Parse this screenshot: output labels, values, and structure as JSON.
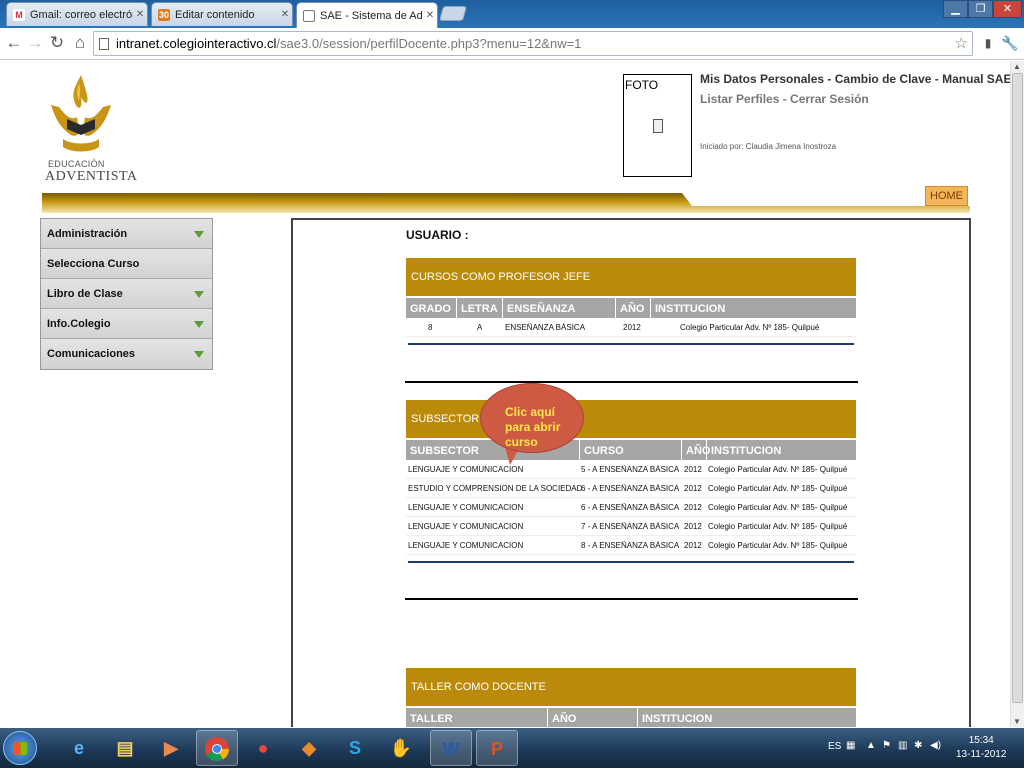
{
  "browser": {
    "tabs": [
      {
        "label": "Gmail: correo electrónico c",
        "icon": "gmail-icon"
      },
      {
        "label": "Editar contenido",
        "icon": "site-icon"
      },
      {
        "label": "SAE - Sistema de Administ",
        "icon": "page-icon",
        "active": true
      }
    ],
    "url_host": "intranet.colegiointeractivo.cl",
    "url_path": "/sae3.0/session/perfilDocente.php3?menu=12&nw=1"
  },
  "header": {
    "logo_line1": "EDUCACIÓN",
    "logo_line2": "ADVENTISTA",
    "foto_label": "FOTO",
    "links": {
      "mis_datos": "Mis Datos Personales",
      "cambio_clave": "Cambio de Clave",
      "manual": "Manual SAE",
      "listar_perfiles": "Listar Perfiles",
      "cerrar_sesion": "Cerrar Sesión",
      "sep": " - "
    },
    "session_info": "Iniciado por: Claudia Jimena Inostroza",
    "home": "HOME"
  },
  "sidebar": {
    "items": [
      {
        "label": "Administración",
        "has_submenu": true
      },
      {
        "label": "Selecciona Curso",
        "has_submenu": false
      },
      {
        "label": "Libro de Clase",
        "has_submenu": true
      },
      {
        "label": "Info.Colegio",
        "has_submenu": true
      },
      {
        "label": "Comunicaciones",
        "has_submenu": true
      }
    ]
  },
  "main": {
    "usuario_label": "USUARIO :",
    "profesor_jefe": {
      "title": "CURSOS COMO PROFESOR JEFE",
      "columns": [
        "GRADO",
        "LETRA",
        "ENSEÑANZA",
        "AÑO",
        "INSTITUCION"
      ],
      "rows": [
        [
          "8",
          "A",
          "ENSEÑANZA BÁSICA",
          "2012",
          "Colegio Particular Adv. Nº 185- Quilpué"
        ]
      ]
    },
    "subsector": {
      "title": "SUBSECTOR CO",
      "columns": [
        "SUBSECTOR",
        "CURSO",
        "AÑO",
        "INSTITUCION"
      ],
      "rows": [
        [
          "LENGUAJE Y COMUNICACION",
          "5 - A ENSEÑANZA BÁSICA",
          "2012",
          "Colegio Particular Adv. Nº 185- Quilpué"
        ],
        [
          "ESTUDIO Y COMPRENSION DE LA SOCIEDAD",
          "6 - A ENSEÑANZA BÁSICA",
          "2012",
          "Colegio Particular Adv. Nº 185- Quilpué"
        ],
        [
          "LENGUAJE Y COMUNICACION",
          "6 - A ENSEÑANZA BÁSICA",
          "2012",
          "Colegio Particular Adv. Nº 185- Quilpué"
        ],
        [
          "LENGUAJE Y COMUNICACION",
          "7 - A ENSEÑANZA BÁSICA",
          "2012",
          "Colegio Particular Adv. Nº 185- Quilpué"
        ],
        [
          "LENGUAJE Y COMUNICACION",
          "8 - A ENSEÑANZA BÁSICA",
          "2012",
          "Colegio Particular Adv. Nº 185- Quilpué"
        ]
      ]
    },
    "taller": {
      "title": "TALLER COMO DOCENTE",
      "columns": [
        "TALLER",
        "AÑO",
        "INSTITUCION"
      ]
    },
    "callout": [
      "Clic aquí",
      "para abrir",
      "curso"
    ]
  },
  "taskbar": {
    "language": "ES",
    "time": "15:34",
    "date": "13-11-2012",
    "apps": [
      "internet-explorer-icon",
      "file-explorer-icon",
      "media-icon",
      "chrome-icon",
      "app-icon",
      "app2-icon",
      "skype-icon",
      "glove-icon",
      "word-icon",
      "powerpoint-icon"
    ]
  },
  "colors": {
    "gold": "#bb8a0a",
    "header_gray": "#a6a6a6",
    "callout": "#cf5a44"
  }
}
